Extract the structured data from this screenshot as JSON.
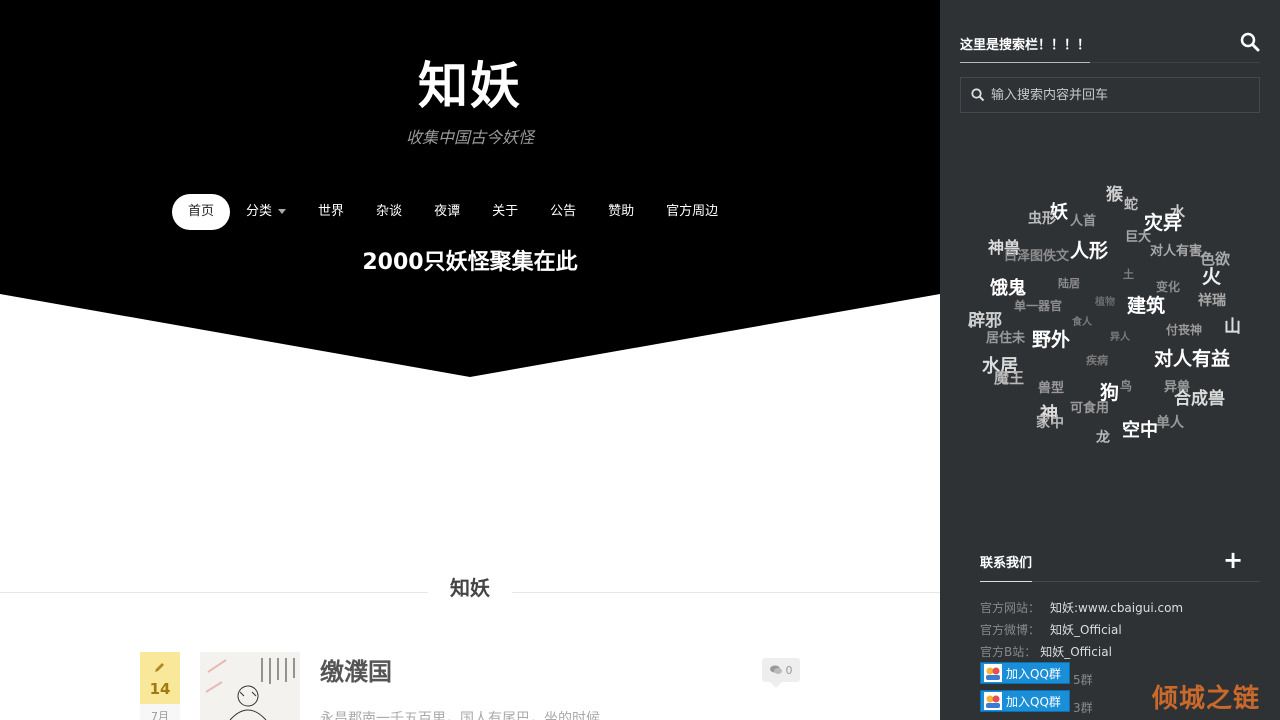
{
  "site": {
    "title": "知妖",
    "subtitle": "收集中国古今妖怪",
    "tagline": "2000只妖怪聚集在此"
  },
  "nav": {
    "home": "首页",
    "category": "分类",
    "world": "世界",
    "misc": "杂谈",
    "night": "夜谭",
    "about": "关于",
    "notice": "公告",
    "sponsor": "赞助",
    "merch": "官方周边"
  },
  "section": {
    "title": "知妖"
  },
  "post": {
    "day": "14",
    "month": "7月",
    "title": "缴濮国",
    "excerpt": "永昌郡南一千五百里，国人有尾巴，坐的时候",
    "comments": "0"
  },
  "sidebar": {
    "search_heading": "这里是搜索栏！！！！",
    "search_placeholder": "输入搜索内容并回车",
    "tags": [
      {
        "t": "猴",
        "c": "#cfcfcf"
      },
      {
        "t": "妖",
        "c": "#ffffff"
      },
      {
        "t": "蛇",
        "c": "#bdbdbd"
      },
      {
        "t": "水",
        "c": "#cfcfcf"
      },
      {
        "t": "虫形",
        "c": "#bdbdbd"
      },
      {
        "t": "人首",
        "c": "#9a9a9a"
      },
      {
        "t": "灾异",
        "c": "#ffffff"
      },
      {
        "t": "巨大",
        "c": "#a8a8a8"
      },
      {
        "t": "神兽",
        "c": "#dcdcdc"
      },
      {
        "t": "人形",
        "c": "#ffffff"
      },
      {
        "t": "白泽图佚文",
        "c": "#8d8d8d"
      },
      {
        "t": "对人有害",
        "c": "#a8a8a8"
      },
      {
        "t": "色欲",
        "c": "#a8a8a8"
      },
      {
        "t": "火",
        "c": "#eeeeee"
      },
      {
        "t": "土",
        "c": "#7e7e7e"
      },
      {
        "t": "饿鬼",
        "c": "#ffffff"
      },
      {
        "t": "陆居",
        "c": "#8a8a8a"
      },
      {
        "t": "变化",
        "c": "#8d8d8d"
      },
      {
        "t": "建筑",
        "c": "#ffffff"
      },
      {
        "t": "祥瑞",
        "c": "#a8a8a8"
      },
      {
        "t": "单一器官",
        "c": "#8d8d8d"
      },
      {
        "t": "植物",
        "c": "#6a6a6a"
      },
      {
        "t": "辟邪",
        "c": "#d0d0d0"
      },
      {
        "t": "食人",
        "c": "#7a7a7a"
      },
      {
        "t": "山",
        "c": "#dcdcdc"
      },
      {
        "t": "居住未",
        "c": "#9a9a9a"
      },
      {
        "t": "野外",
        "c": "#ffffff"
      },
      {
        "t": "异人",
        "c": "#7a7a7a"
      },
      {
        "t": "付丧神",
        "c": "#9a9a9a"
      },
      {
        "t": "水居",
        "c": "#dcdcdc"
      },
      {
        "t": "疾病",
        "c": "#7a7a7a"
      },
      {
        "t": "对人有益",
        "c": "#ffffff"
      },
      {
        "t": "魔王",
        "c": "#b8b8b8"
      },
      {
        "t": "兽型",
        "c": "#9a9a9a"
      },
      {
        "t": "狗",
        "c": "#ffffff"
      },
      {
        "t": "鸟",
        "c": "#8d8d8d"
      },
      {
        "t": "异兽",
        "c": "#9a9a9a"
      },
      {
        "t": "合成兽",
        "c": "#dcdcdc"
      },
      {
        "t": "可食用",
        "c": "#9a9a9a"
      },
      {
        "t": "神",
        "c": "#dcdcdc"
      },
      {
        "t": "家中",
        "c": "#b8b8b8"
      },
      {
        "t": "单人",
        "c": "#9a9a9a"
      },
      {
        "t": "空中",
        "c": "#ffffff"
      },
      {
        "t": "龙",
        "c": "#b8b8b8"
      }
    ],
    "contact_title": "联系我们",
    "site_label": "官方网站：",
    "site_value": "知妖:www.cbaigui.com",
    "weibo_label": "官方微博：",
    "weibo_value": "知妖_Official",
    "bili_label": "官方B站：",
    "bili_value": "知妖_Official",
    "qq_button": "加入QQ群",
    "qq_group_1": "5群",
    "qq_group_2": "3群"
  },
  "watermark": "倾城之链"
}
